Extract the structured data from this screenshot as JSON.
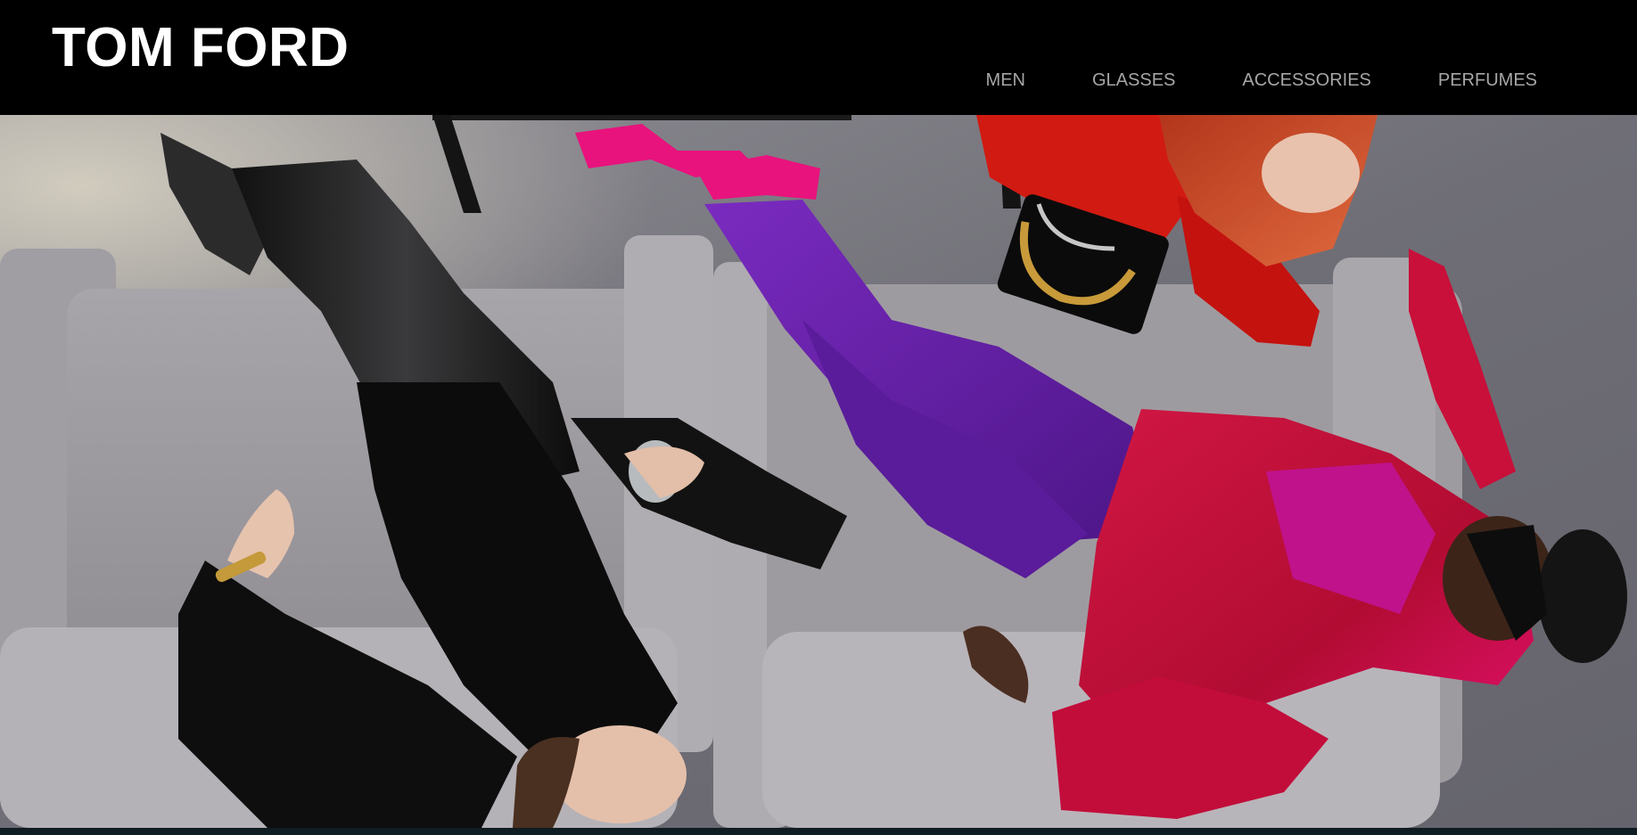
{
  "brand": {
    "logo_text": "TOM FORD"
  },
  "nav": {
    "items": [
      {
        "label": "MEN"
      },
      {
        "label": "GLASSES"
      },
      {
        "label": "ACCESSORIES"
      },
      {
        "label": "PERFUMES"
      }
    ]
  },
  "hero": {
    "image": "campaign photo: three models lounging on grey sofas, viewed from above"
  },
  "colors": {
    "header_bg": "#000000",
    "logo": "#ffffff",
    "nav_text": "#a6a6a6",
    "carpet": "#77767d",
    "sofa": "#9c999e",
    "velvet_red": "#c8103a",
    "purple": "#6a22a6",
    "magenta": "#e0117a",
    "orange_red": "#d11a12"
  }
}
